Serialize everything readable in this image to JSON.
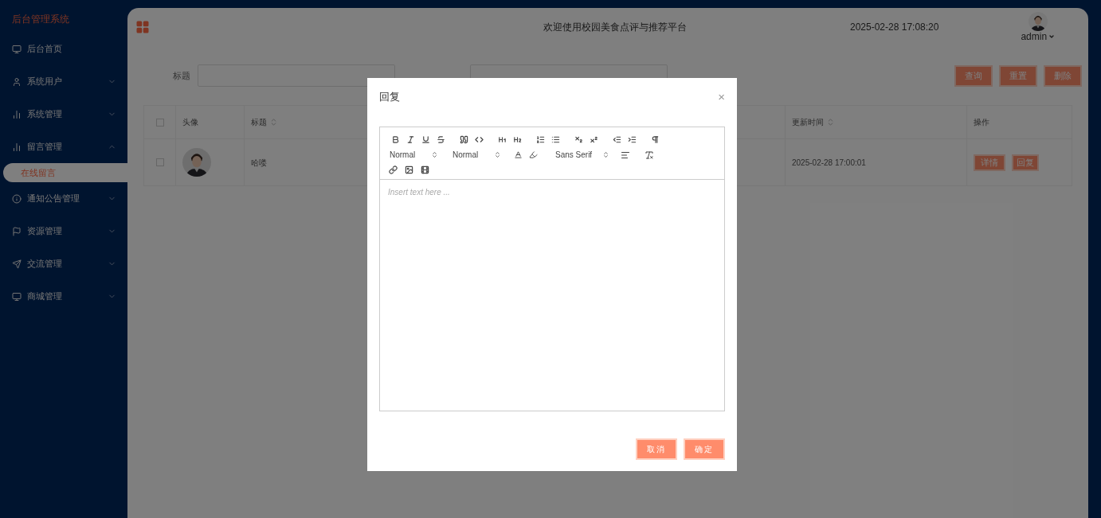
{
  "sidebar": {
    "title": "后台管理系统",
    "items": [
      {
        "label": "后台首页",
        "expandable": false
      },
      {
        "label": "系统用户",
        "expandable": true,
        "expanded": false
      },
      {
        "label": "系统管理",
        "expandable": true,
        "expanded": false
      },
      {
        "label": "留言管理",
        "expandable": true,
        "expanded": true,
        "children": [
          {
            "label": "在线留言",
            "selected": true
          }
        ]
      },
      {
        "label": "通知公告管理",
        "expandable": true,
        "expanded": false
      },
      {
        "label": "资源管理",
        "expandable": true,
        "expanded": false
      },
      {
        "label": "交流管理",
        "expandable": true,
        "expanded": false
      },
      {
        "label": "商城管理",
        "expandable": true,
        "expanded": false
      }
    ]
  },
  "header": {
    "title": "欢迎使用校园美食点评与推荐平台",
    "datetime": "2025-02-28 17:08:20",
    "user": "admin"
  },
  "search": {
    "fields": [
      {
        "kind": "labeled",
        "label": "标题"
      },
      {
        "kind": "unlabeled"
      }
    ],
    "buttons": [
      "查询",
      "重置",
      "删除"
    ]
  },
  "table": {
    "header_checked": false,
    "columns": [
      {
        "label": "头像",
        "sortable": false
      },
      {
        "label": "标题",
        "sortable": true
      },
      {
        "label": "更新时间",
        "sortable": true
      },
      {
        "label": "操作",
        "sortable": false
      }
    ],
    "rows": [
      {
        "checked": false,
        "title": "哈喽",
        "updated": "2025-02-28 17:00:01",
        "actions": [
          "详情",
          "回复"
        ]
      }
    ]
  },
  "dialog": {
    "title": "回复",
    "close": "×",
    "pickers": [
      "Normal",
      "Normal",
      "Sans Serif"
    ],
    "placeholder": "Insert text here ...",
    "buttons": [
      "取消",
      "确定"
    ]
  }
}
